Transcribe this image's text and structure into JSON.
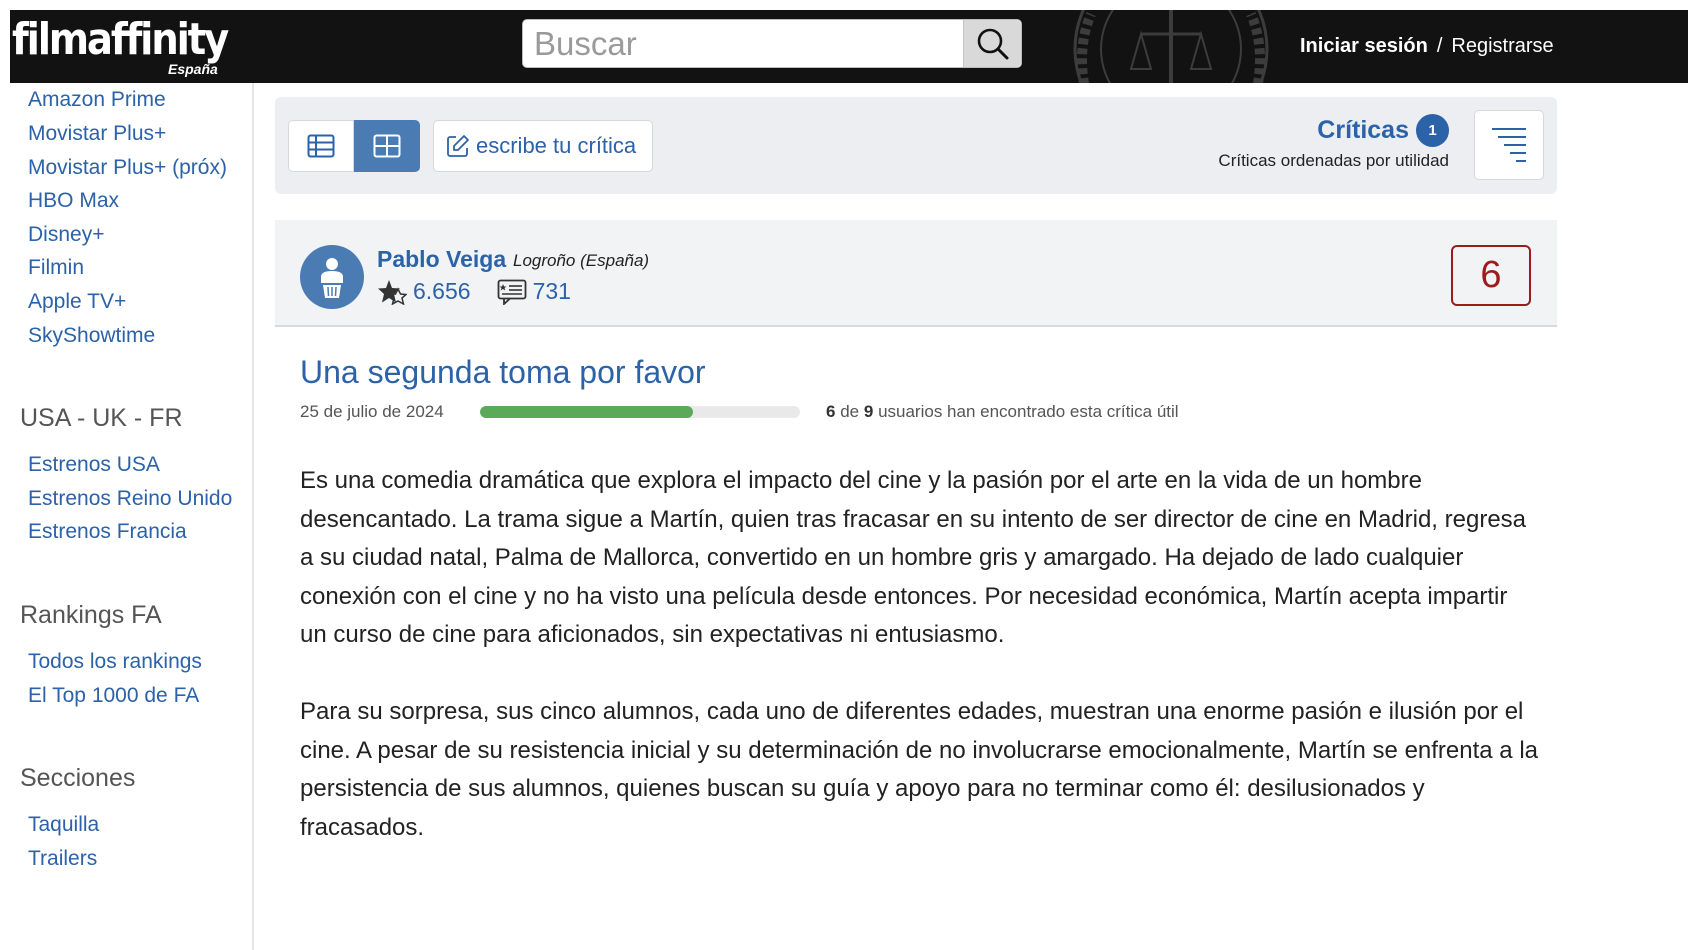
{
  "header": {
    "logo_text": "filmaffinity",
    "logo_sub": "España",
    "search_placeholder": "Buscar",
    "login": "Iniciar sesión",
    "separator": "/",
    "register": "Registrarse"
  },
  "sidebar": {
    "platforms": [
      "Amazon Prime",
      "Movistar Plus+",
      "Movistar Plus+ (próx)",
      "HBO Max",
      "Disney+",
      "Filmin",
      "Apple TV+",
      "SkyShowtime"
    ],
    "sections": [
      {
        "title": "USA - UK - FR",
        "links": [
          "Estrenos USA",
          "Estrenos Reino Unido",
          "Estrenos Francia"
        ]
      },
      {
        "title": "Rankings FA",
        "links": [
          "Todos los rankings",
          "El Top 1000 de FA"
        ]
      },
      {
        "title": "Secciones",
        "links": [
          "Taquilla",
          "Trailers"
        ]
      }
    ]
  },
  "toolbar": {
    "write_review": "escribe tu crítica",
    "reviews_title": "Críticas",
    "reviews_count": "1",
    "reviews_sort": "Críticas ordenadas por utilidad"
  },
  "review": {
    "author": "Pablo Veiga",
    "location": "Logroño (España)",
    "ratings_count": "6.656",
    "reviews_count": "731",
    "rating": "6",
    "title": "Una segunda toma por favor",
    "date": "25 de julio de 2024",
    "helpful_yes": "6",
    "helpful_of": "de",
    "helpful_total": "9",
    "helpful_text": "usuarios han encontrado esta crítica útil",
    "helpful_fraction": 0.667,
    "paragraphs": [
      "Es una comedia dramática que explora el impacto del cine y la pasión por el arte en la vida de un hombre desencantado. La trama sigue a Martín, quien tras fracasar en su intento de ser director de cine en Madrid, regresa a su ciudad natal, Palma de Mallorca, convertido en un hombre gris y amargado. Ha dejado de lado cualquier conexión con el cine y no ha visto una película desde entonces. Por necesidad económica, Martín acepta impartir un curso de cine para aficionados, sin expectativas ni entusiasmo.",
      "Para su sorpresa, sus cinco alumnos, cada uno de diferentes edades, muestran una enorme pasión e ilusión por el cine. A pesar de su resistencia inicial y su determinación de no involucrarse emocionalmente, Martín se enfrenta a la persistencia de sus alumnos, quienes buscan su guía y apoyo para no terminar como él: desilusionados y fracasados."
    ]
  },
  "colors": {
    "link": "#2b62a8",
    "header_bg": "#121212",
    "rating": "#9b1c1c",
    "helpful_bar": "#5aaa5a"
  }
}
